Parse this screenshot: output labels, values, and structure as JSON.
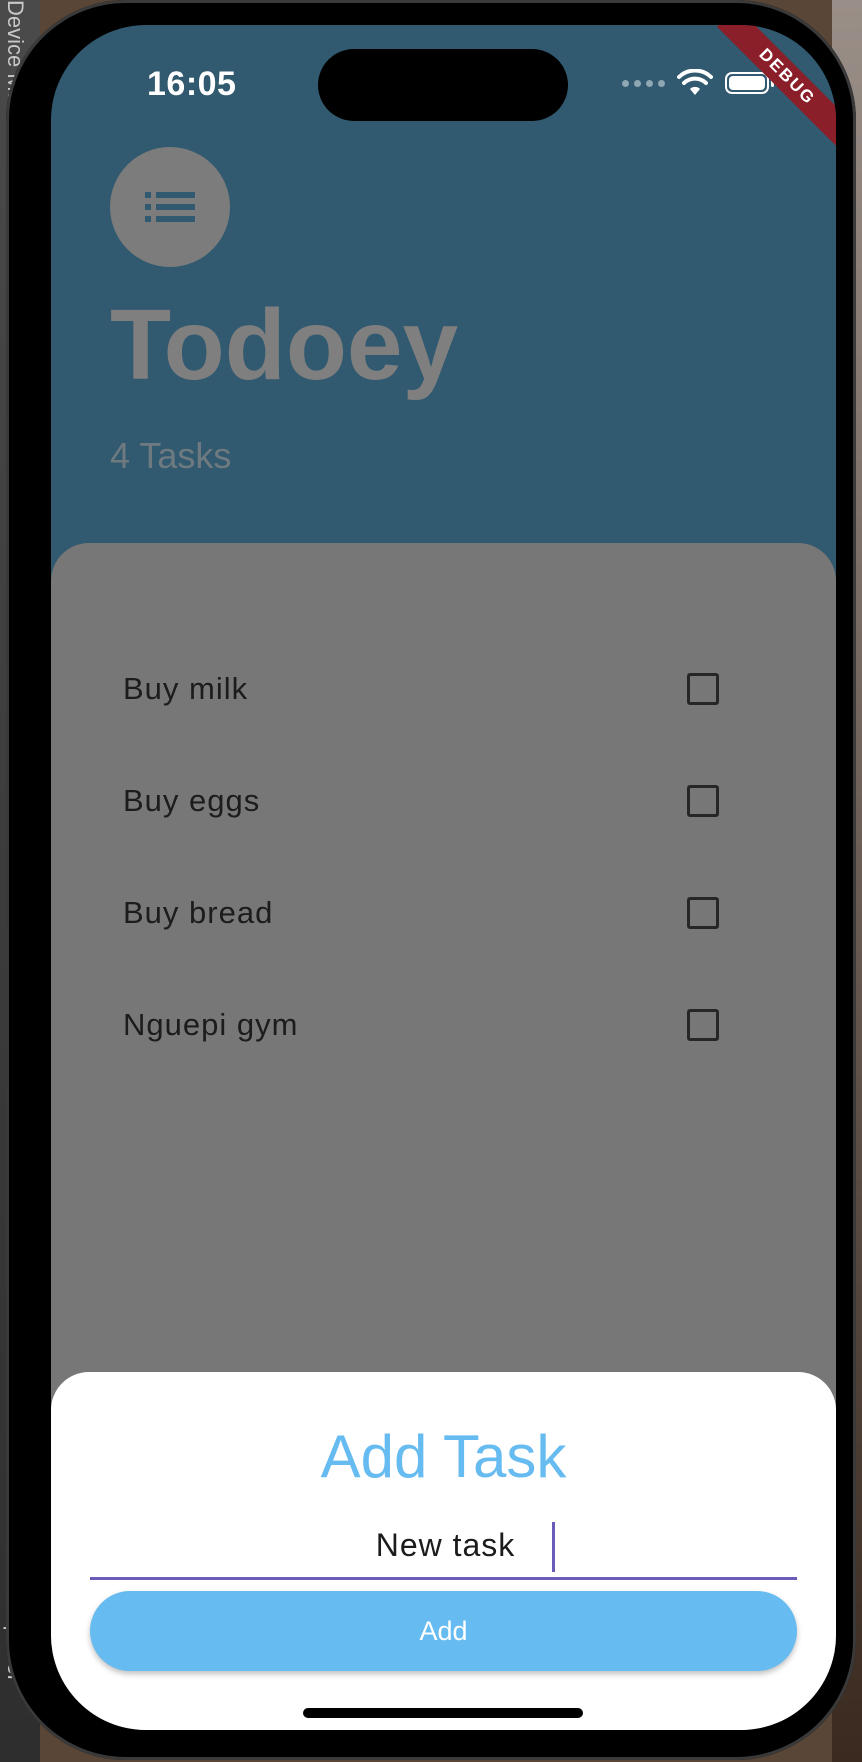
{
  "background": {
    "left_labels": [
      "Device Ma",
      "Explorer"
    ]
  },
  "status_bar": {
    "time": "16:05",
    "icons": [
      "signal-dots-icon",
      "wifi-icon",
      "battery-icon"
    ]
  },
  "debug_banner": "DEBUG",
  "header": {
    "menu_icon": "list-icon",
    "title": "Todoey",
    "task_count": "4 Tasks",
    "background_color": "#31596f"
  },
  "tasks": [
    {
      "label": "Buy milk",
      "checked": false
    },
    {
      "label": "Buy eggs",
      "checked": false
    },
    {
      "label": "Buy bread",
      "checked": false
    },
    {
      "label": "Nguepi gym",
      "checked": false
    }
  ],
  "add_sheet": {
    "title": "Add Task",
    "input_value": "New task",
    "button_label": "Add",
    "accent_color": "#66bbf0",
    "underline_color": "#6a5cb8"
  }
}
